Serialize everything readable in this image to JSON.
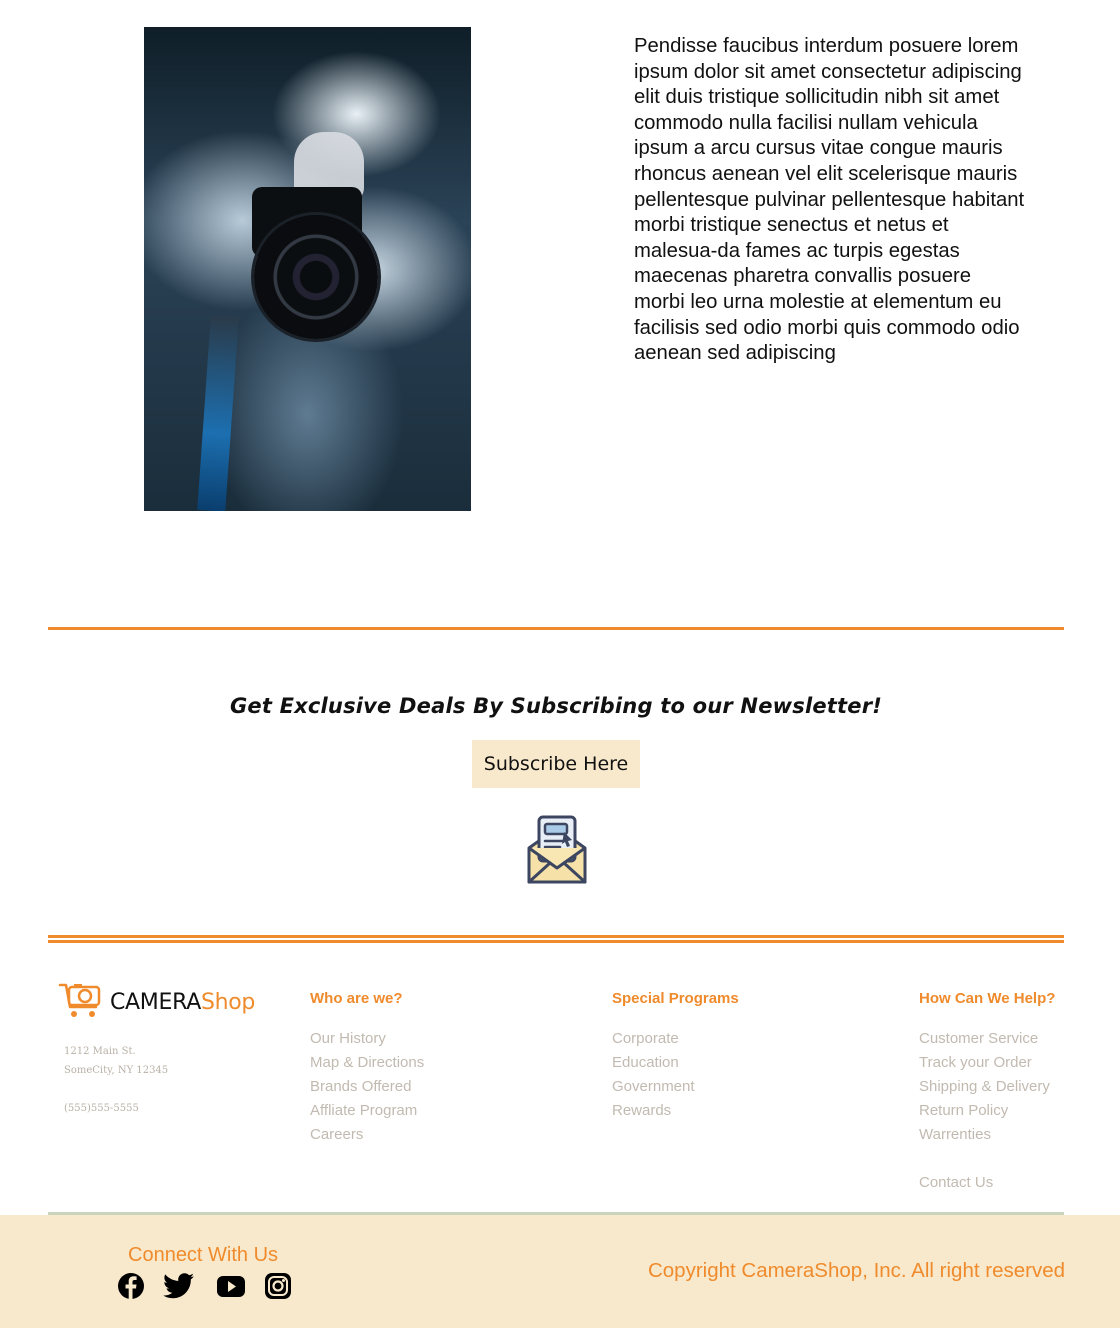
{
  "hero": {
    "paragraph": "Pendisse faucibus interdum posuere lorem ipsum dolor sit amet consectetur adipiscing elit duis tristique sollicitudin nibh sit amet commodo nulla facilisi nullam vehicula ipsum a arcu cursus vitae congue mauris rhoncus aenean vel elit scelerisque mauris pellentesque pulvinar pellentesque habitant morbi tristique senectus et netus et malesua-da fames ac turpis egestas maecenas pharetra convallis posuere morbi leo urna molestie at elementum eu facilisis sed odio morbi quis commodo odio aenean sed adipiscing"
  },
  "newsletter": {
    "heading": "Get Exclusive Deals By Subscribing to our Newsletter!",
    "button_label": "Subscribe Here",
    "icon": "envelope-letter-icon"
  },
  "footer": {
    "logo": {
      "part1": "CAMERA",
      "part2": "Shop",
      "icon": "camera-cart-icon"
    },
    "address": {
      "line1": "1212 Main St.",
      "line2": "SomeCity, NY 12345",
      "phone": "(555)555-5555"
    },
    "columns": [
      {
        "title": "Who are we?",
        "links": [
          "Our History",
          "Map & Directions",
          "Brands Offered",
          "Affliate Program",
          "Careers"
        ]
      },
      {
        "title": "Special Programs",
        "links": [
          "Corporate",
          "Education",
          "Government",
          "Rewards"
        ]
      },
      {
        "title": "How Can We Help?",
        "links": [
          "Customer Service",
          "Track your Order",
          "Shipping & Delivery",
          "Return Policy",
          "Warrenties"
        ],
        "extra_link": "Contact Us"
      }
    ],
    "connect_title": "Connect With Us",
    "social": [
      "facebook-icon",
      "twitter-icon",
      "youtube-icon",
      "instagram-icon"
    ],
    "copyright": "Copyright CameraShop, Inc. All right reserved"
  },
  "colors": {
    "accent": "#ef8b2c",
    "band": "#f8e9cc",
    "link_gray": "#c2bab0"
  }
}
